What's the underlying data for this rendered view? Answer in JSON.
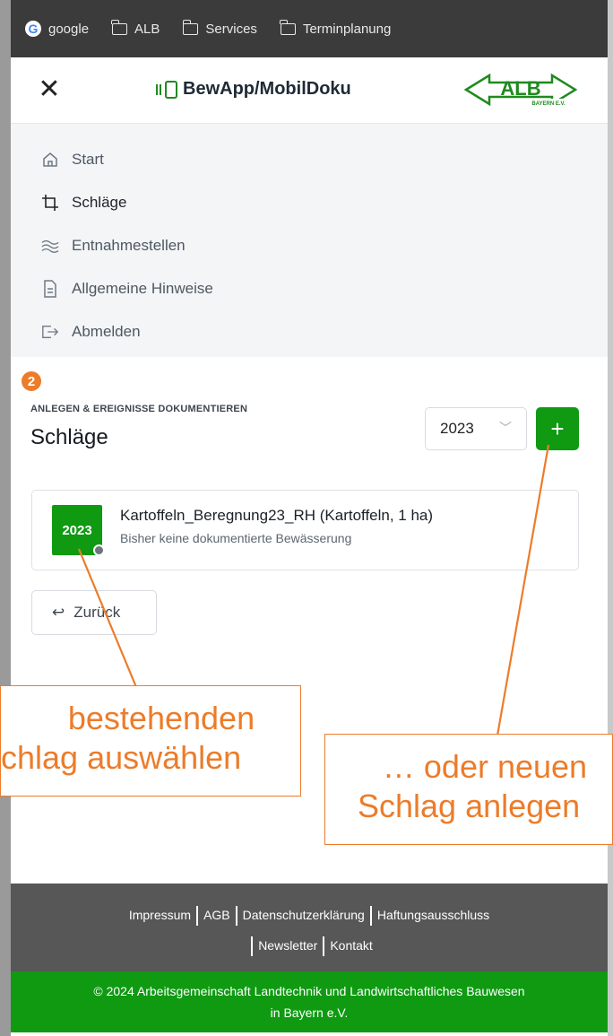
{
  "bookmarks": [
    {
      "label": "google",
      "icon": "google-icon"
    },
    {
      "label": "ALB",
      "icon": "folder-icon"
    },
    {
      "label": "Services",
      "icon": "folder-icon"
    },
    {
      "label": "Terminplanung",
      "icon": "folder-icon"
    }
  ],
  "header": {
    "close_glyph": "✕",
    "brand": "BewApp/MobilDoku",
    "logo_text": "ALB",
    "logo_sub": "BAYERN E.V."
  },
  "nav": [
    {
      "label": "Start",
      "icon": "home-icon"
    },
    {
      "label": "Schläge",
      "icon": "crop-icon"
    },
    {
      "label": "Entnahmestellen",
      "icon": "waves-icon"
    },
    {
      "label": "Allgemeine Hinweise",
      "icon": "document-icon"
    },
    {
      "label": "Abmelden",
      "icon": "logout-icon"
    }
  ],
  "content": {
    "step_badge": "2",
    "eyebrow": "ANLEGEN & EREIGNISSE DOKUMENTIEREN",
    "title": "Schläge",
    "year_select": {
      "value": "2023",
      "chevron": "﹀"
    },
    "add_label": "+",
    "card": {
      "year": "2023",
      "title": "Kartoffeln_Beregnung23_RH (Kartoffeln, 1 ha)",
      "subtitle": "Bisher keine dokumentierte Bewässerung"
    },
    "back_label": "Zurück",
    "back_glyph": "↩"
  },
  "annotations": {
    "left_line1": "bestehenden",
    "left_line2": "chlag auswählen",
    "right_line1": "… oder neuen",
    "right_line2": "Schlag anlegen",
    "color": "#ec7c2a"
  },
  "footer": {
    "links": [
      "Impressum",
      "AGB",
      "Datenschutzerklärung",
      "Haftungsausschluss",
      "Newsletter",
      "Kontakt"
    ],
    "copyright_line1": "© 2024 Arbeitsgemeinschaft Landtechnik und Landwirtschaftliches Bauwesen",
    "copyright_line2": "in Bayern e.V."
  },
  "colors": {
    "brand_green": "#0f9a12",
    "footer_gray": "#575757",
    "bookmarks_bg": "#3b3b3b",
    "nav_bg": "#f3f5f7"
  }
}
